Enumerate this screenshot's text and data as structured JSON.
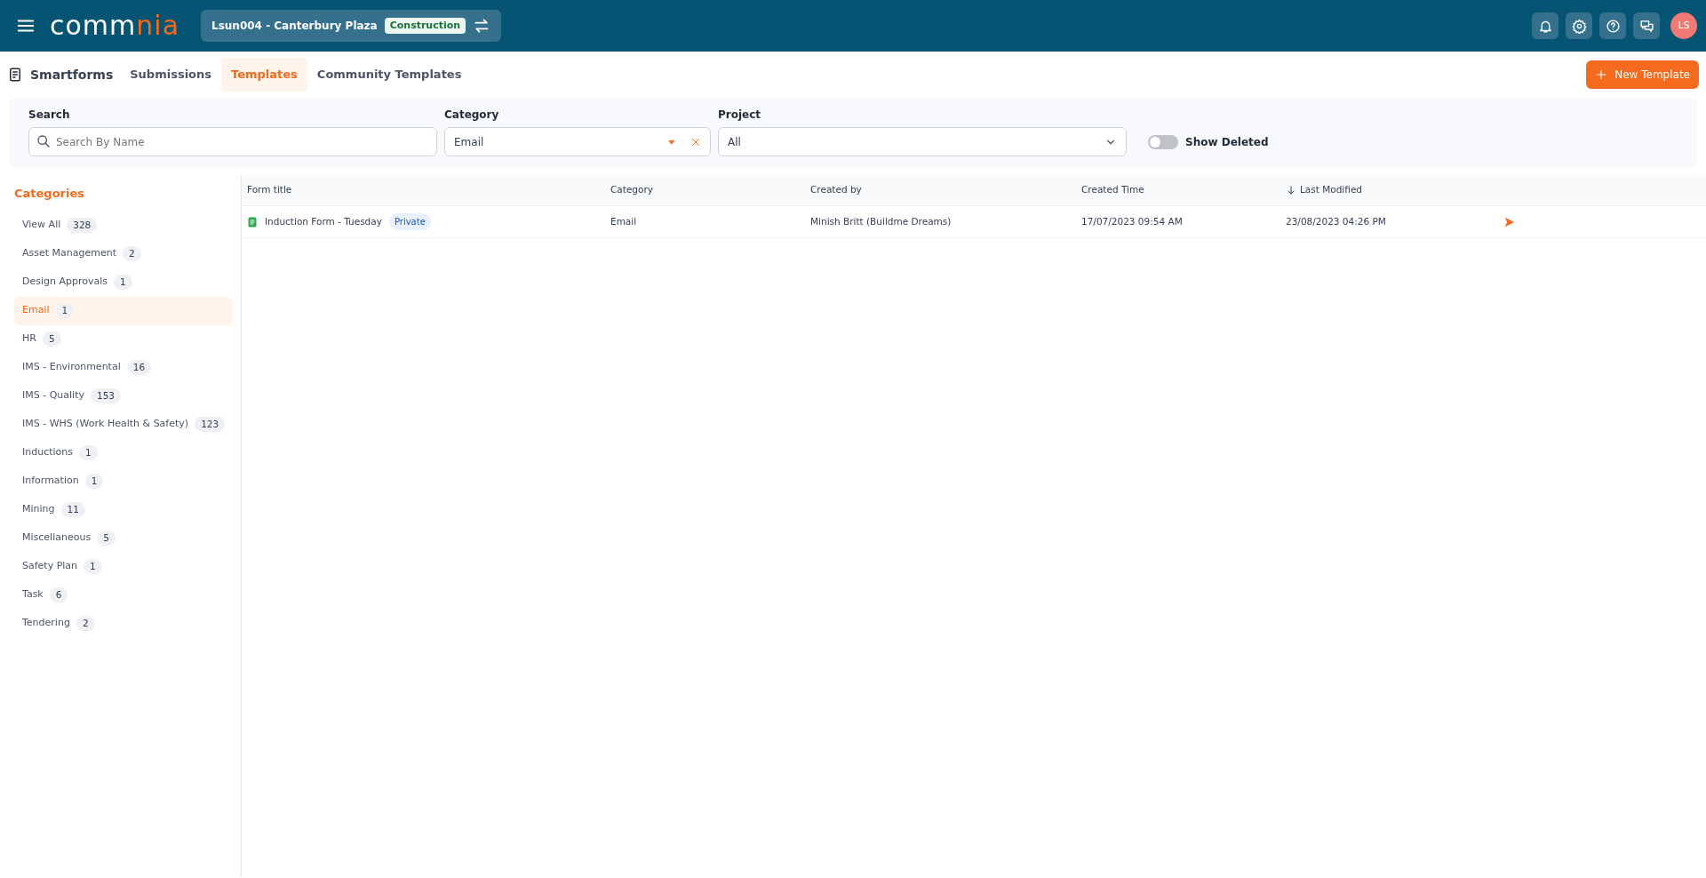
{
  "header": {
    "logo": [
      {
        "text": "comm",
        "accent": false
      },
      {
        "text": "nia",
        "accent": true
      }
    ],
    "project": "Lsun004 - Canterbury Plaza",
    "project_tag": "Construction",
    "avatar": "LS"
  },
  "page_title": "Smartforms",
  "tabs": [
    {
      "label": "Submissions",
      "selected": false
    },
    {
      "label": "Templates",
      "selected": true
    },
    {
      "label": "Community Templates",
      "selected": false
    }
  ],
  "new_button": "New Template",
  "filters": {
    "search": {
      "label": "Search",
      "placeholder": "Search By Name"
    },
    "category": {
      "label": "Category",
      "value": "Email"
    },
    "project": {
      "label": "Project",
      "value": "All"
    },
    "show_deleted": {
      "label": "Show Deleted",
      "on": false
    }
  },
  "sidebar": {
    "title": "Categories",
    "items": [
      {
        "label": "View All",
        "count": "328",
        "selected": false
      },
      {
        "label": "Asset Management",
        "count": "2",
        "selected": false
      },
      {
        "label": "Design Approvals",
        "count": "1",
        "selected": false
      },
      {
        "label": "Email",
        "count": "1",
        "selected": true
      },
      {
        "label": "HR",
        "count": "5",
        "selected": false
      },
      {
        "label": "IMS - Environmental",
        "count": "16",
        "selected": false
      },
      {
        "label": "IMS - Quality",
        "count": "153",
        "selected": false
      },
      {
        "label": "IMS - WHS (Work Health & Safety)",
        "count": "123",
        "selected": false
      },
      {
        "label": "Inductions",
        "count": "1",
        "selected": false
      },
      {
        "label": "Information",
        "count": "1",
        "selected": false
      },
      {
        "label": "Mining",
        "count": "11",
        "selected": false
      },
      {
        "label": "Miscellaneous",
        "count": "5",
        "selected": false
      },
      {
        "label": "Safety Plan",
        "count": "1",
        "selected": false
      },
      {
        "label": "Task",
        "count": "6",
        "selected": false
      },
      {
        "label": "Tendering",
        "count": "2",
        "selected": false
      }
    ]
  },
  "table": {
    "columns": [
      {
        "label": "Form title",
        "sorted": false
      },
      {
        "label": "Category",
        "sorted": false
      },
      {
        "label": "Created by",
        "sorted": false
      },
      {
        "label": "Created Time",
        "sorted": false
      },
      {
        "label": "Last Modified",
        "sorted": true
      }
    ],
    "rows": [
      {
        "title": "Induction Form - Tuesday",
        "tag": "Private",
        "category": "Email",
        "created_by": "Minish Britt (Buildme Dreams)",
        "created_time": "17/07/2023 09:54 AM",
        "last_modified": "23/08/2023 04:26 PM"
      }
    ]
  }
}
